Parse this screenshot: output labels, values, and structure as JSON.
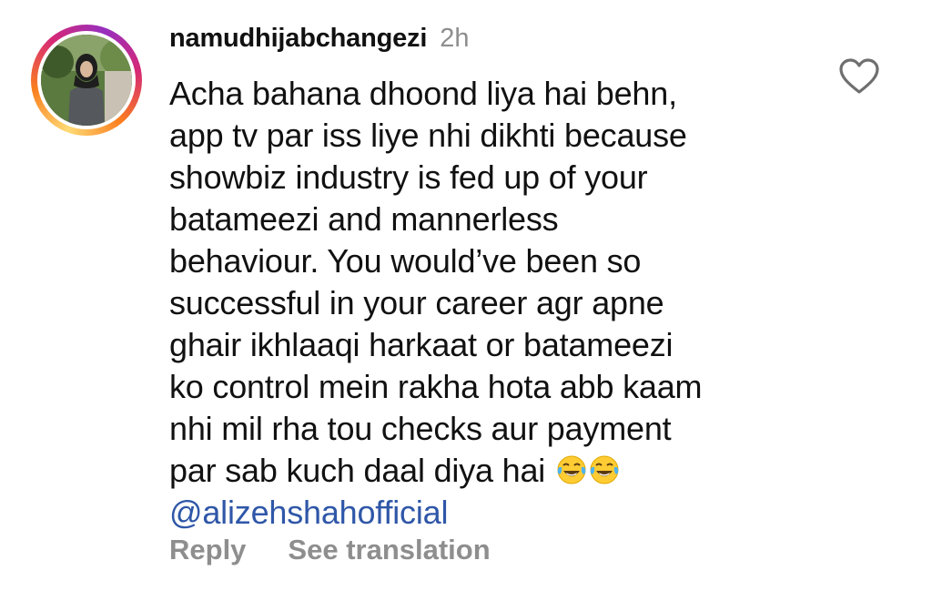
{
  "comment": {
    "username": "namudhijabchangezi",
    "time": "2h",
    "lines": [
      "Acha bahana dhoond liya hai behn,",
      "app tv par iss liye nhi dikhti because",
      "showbiz industry is fed up of your",
      "batameezi and mannerless",
      "behaviour. You would’ve been so",
      "successful in your career agr apne",
      "ghair ikhlaaqi harkaat or batameezi",
      "ko control mein rakha hota abb kaam",
      "nhi mil rha tou checks aur payment",
      "par sab kuch daal diya hai"
    ],
    "emojis": [
      "face-with-tears-of-joy",
      "face-with-tears-of-joy"
    ],
    "mention": "@alizehshahofficial"
  },
  "actions": {
    "reply_label": "Reply",
    "translate_label": "See translation"
  },
  "icons": {
    "like": "heart-icon",
    "avatar": "avatar"
  },
  "colors": {
    "text": "#111111",
    "muted": "#8e8e8e",
    "mention": "#2f57a8",
    "ring_start": "#feda75",
    "ring_mid": "#d62976",
    "ring_end": "#962fbf"
  }
}
